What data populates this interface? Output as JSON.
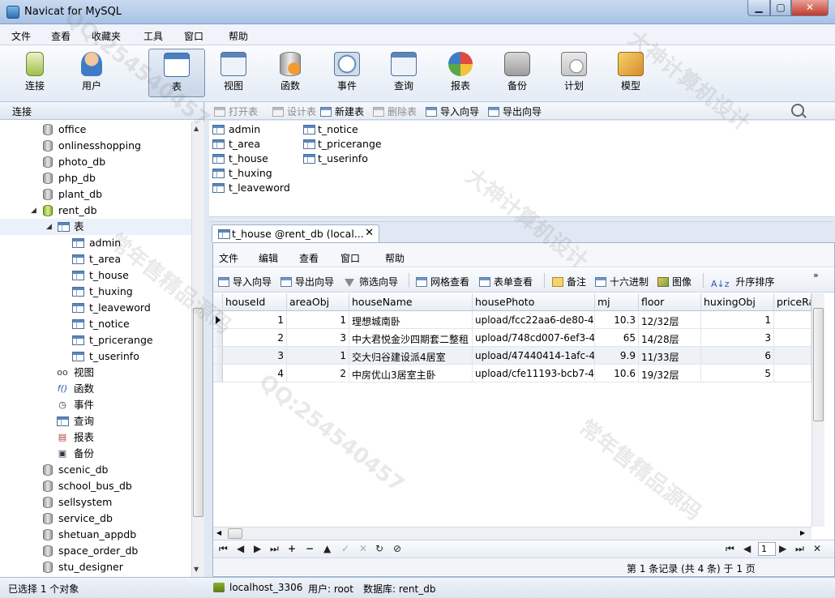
{
  "window": {
    "title": "Navicat for MySQL"
  },
  "menubar": [
    "文件",
    "查看",
    "收藏夹",
    "工具",
    "窗口",
    "帮助"
  ],
  "toolbar": [
    {
      "label": "连接",
      "icon": "plug-connect-icon"
    },
    {
      "label": "用户",
      "icon": "user-icon"
    },
    {
      "label": "表",
      "icon": "table-icon",
      "active": true
    },
    {
      "label": "视图",
      "icon": "view-glasses-icon"
    },
    {
      "label": "函数",
      "icon": "function-icon"
    },
    {
      "label": "事件",
      "icon": "event-clock-icon"
    },
    {
      "label": "查询",
      "icon": "query-icon"
    },
    {
      "label": "报表",
      "icon": "report-icon"
    },
    {
      "label": "备份",
      "icon": "backup-icon"
    },
    {
      "label": "计划",
      "icon": "schedule-icon"
    },
    {
      "label": "模型",
      "icon": "model-icon"
    }
  ],
  "left_panel": {
    "header": "连接",
    "databases_before": [
      "office",
      "onlinesshopping",
      "photo_db",
      "php_db",
      "plant_db"
    ],
    "open_db": "rent_db",
    "tables_node": "表",
    "tables": [
      "admin",
      "t_area",
      "t_house",
      "t_huxing",
      "t_leaveword",
      "t_notice",
      "t_pricerange",
      "t_userinfo"
    ],
    "other_nodes": [
      "视图",
      "函数",
      "事件",
      "查询",
      "报表",
      "备份"
    ],
    "databases_after": [
      "scenic_db",
      "school_bus_db",
      "sellsystem",
      "service_db",
      "shetuan_appdb",
      "space_order_db",
      "stu_designer"
    ]
  },
  "object_toolbar": {
    "open": "打开表",
    "design": "设计表",
    "new": "新建表",
    "delete": "删除表",
    "import": "导入向导",
    "export": "导出向导"
  },
  "object_list": [
    "admin",
    "t_area",
    "t_house",
    "t_huxing",
    "t_leaveword",
    "t_notice",
    "t_pricerange",
    "t_userinfo"
  ],
  "tab": {
    "label": "t_house @rent_db (local..."
  },
  "inner_menu": [
    "文件",
    "编辑",
    "查看",
    "窗口",
    "帮助"
  ],
  "inner_toolbar": {
    "import": "导入向导",
    "export": "导出向导",
    "filter": "筛选向导",
    "grid_view": "网格查看",
    "form_view": "表单查看",
    "memo": "备注",
    "hex": "十六进制",
    "image": "图像",
    "sort": "升序排序"
  },
  "grid": {
    "columns": [
      "houseId",
      "areaObj",
      "houseName",
      "housePhoto",
      "mj",
      "floor",
      "huxingObj",
      "priceRa"
    ],
    "rows": [
      [
        "1",
        "1",
        "理想城南卧",
        "upload/fcc22aa6-de80-4c",
        "10.3",
        "12/32层",
        "1",
        ""
      ],
      [
        "2",
        "3",
        "中大君悦金沙四期套二整租",
        "upload/748cd007-6ef3-4e",
        "65",
        "14/28层",
        "3",
        ""
      ],
      [
        "3",
        "1",
        "交大归谷建设派4居室",
        "upload/47440414-1afc-4e",
        "9.9",
        "11/33层",
        "6",
        ""
      ],
      [
        "4",
        "2",
        "中房优山3居室主卧",
        "upload/cfe11193-bcb7-4e",
        "10.6",
        "19/32层",
        "5",
        ""
      ]
    ]
  },
  "record_status": "第 1 条记录 (共 4 条) 于 1 页",
  "page_number": "1",
  "statusbar": {
    "selected": "已选择 1 个对象",
    "connection": "localhost_3306",
    "user": "用户: root",
    "database": "数据库: rent_db"
  },
  "watermarks": [
    "大神计算机设计",
    "QQ:254540457",
    "常年售精品源码"
  ]
}
